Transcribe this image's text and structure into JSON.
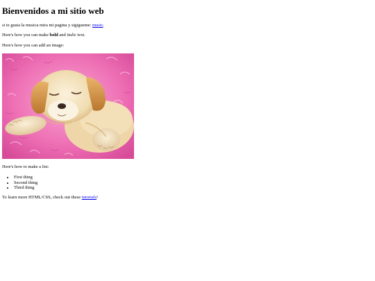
{
  "heading": "Bienvenidos a mi sitio web",
  "music_paragraph": {
    "text": "si te gusta la musica mira mi pagina y sigigueme: ",
    "link_label": "music",
    "after": "."
  },
  "bold_paragraph": {
    "before": "Here's how you can make ",
    "bold": "bold",
    "middle": " and ",
    "italic": "italic",
    "after": " text."
  },
  "image_paragraph": "Here's how you can add an image:",
  "image": {
    "subject": "sleeping golden puppy on pink fur blanket",
    "colors": {
      "pink_light": "#f7a8d4",
      "pink_mid": "#ee6fb4",
      "pink_deep": "#d64a98",
      "fur_cream": "#f6e6c4",
      "fur_gold": "#e3b06a",
      "fur_brown": "#b9762e"
    }
  },
  "list_paragraph": "Here's how to make a list:",
  "list_items": [
    "First thing",
    "Second thing",
    "Third thing"
  ],
  "learn_paragraph": {
    "before": "To learn more HTML/CSS, check out these ",
    "link_label": "tutorials",
    "after": "!"
  },
  "colors": {
    "link": "#0000ee",
    "text": "#000000",
    "background": "#ffffff"
  }
}
